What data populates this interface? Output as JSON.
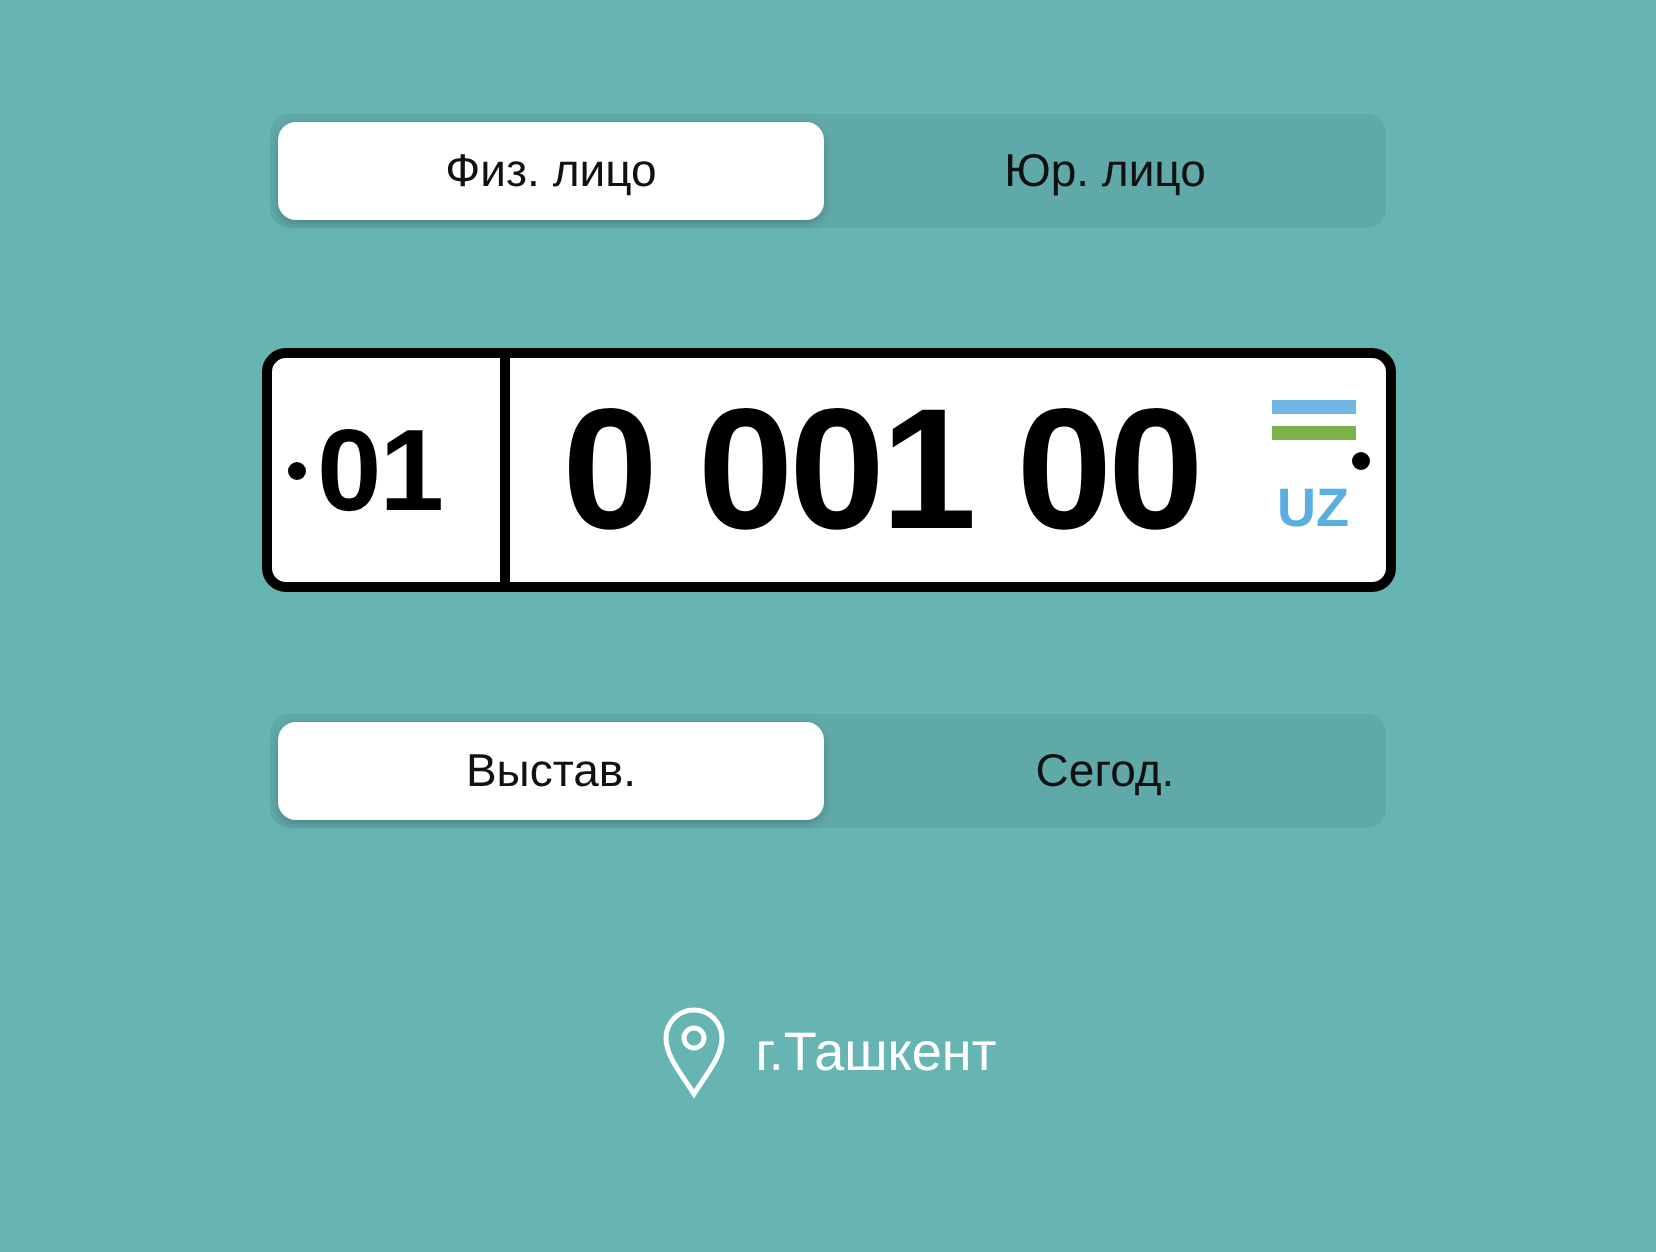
{
  "person_type_tabs": [
    {
      "label": "Физ. лицо",
      "selected": true
    },
    {
      "label": "Юр. лицо",
      "selected": false
    }
  ],
  "plate": {
    "region": "01",
    "number": "0 001 00",
    "country": "UZ"
  },
  "sort_tabs": [
    {
      "label": "Выстав.",
      "selected": true
    },
    {
      "label": "Сегод.",
      "selected": false
    }
  ],
  "location": {
    "city": "г.Ташкент"
  }
}
